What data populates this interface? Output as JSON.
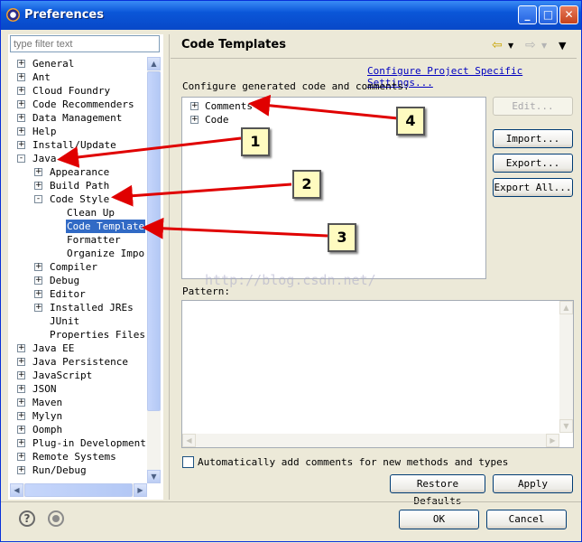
{
  "window": {
    "title": "Preferences"
  },
  "filter": {
    "placeholder": "type filter text"
  },
  "tree": [
    {
      "label": "General",
      "expander": "+",
      "selected": false
    },
    {
      "label": "Ant",
      "expander": "+",
      "selected": false
    },
    {
      "label": "Cloud Foundry",
      "expander": "+",
      "selected": false
    },
    {
      "label": "Code Recommenders",
      "expander": "+",
      "selected": false
    },
    {
      "label": "Data Management",
      "expander": "+",
      "selected": false
    },
    {
      "label": "Help",
      "expander": "+",
      "selected": false
    },
    {
      "label": "Install/Update",
      "expander": "+",
      "selected": false
    },
    {
      "label": "Java",
      "expander": "-",
      "selected": false
    },
    {
      "label": "Appearance",
      "expander": "+",
      "selected": false
    },
    {
      "label": "Build Path",
      "expander": "+",
      "selected": false
    },
    {
      "label": "Code Style",
      "expander": "-",
      "selected": false
    },
    {
      "label": "Clean Up",
      "expander": "",
      "selected": false
    },
    {
      "label": "Code Templates",
      "expander": "",
      "selected": true
    },
    {
      "label": "Formatter",
      "expander": "",
      "selected": false
    },
    {
      "label": "Organize Imports",
      "expander": "",
      "selected": false
    },
    {
      "label": "Compiler",
      "expander": "+",
      "selected": false
    },
    {
      "label": "Debug",
      "expander": "+",
      "selected": false
    },
    {
      "label": "Editor",
      "expander": "+",
      "selected": false
    },
    {
      "label": "Installed JREs",
      "expander": "+",
      "selected": false
    },
    {
      "label": "JUnit",
      "expander": "",
      "selected": false
    },
    {
      "label": "Properties Files Editor",
      "expander": "",
      "selected": false
    },
    {
      "label": "Java EE",
      "expander": "+",
      "selected": false
    },
    {
      "label": "Java Persistence",
      "expander": "+",
      "selected": false
    },
    {
      "label": "JavaScript",
      "expander": "+",
      "selected": false
    },
    {
      "label": "JSON",
      "expander": "+",
      "selected": false
    },
    {
      "label": "Maven",
      "expander": "+",
      "selected": false
    },
    {
      "label": "Mylyn",
      "expander": "+",
      "selected": false
    },
    {
      "label": "Oomph",
      "expander": "+",
      "selected": false
    },
    {
      "label": "Plug-in Development",
      "expander": "+",
      "selected": false
    },
    {
      "label": "Remote Systems",
      "expander": "+",
      "selected": false
    },
    {
      "label": "Run/Debug",
      "expander": "+",
      "selected": false
    }
  ],
  "page": {
    "title": "Code Templates",
    "project_link": "Configure Project Specific Settings...",
    "configure_label": "Configure generated code and comments:",
    "templates": [
      {
        "label": "Comments",
        "expander": "+"
      },
      {
        "label": "Code",
        "expander": "+"
      }
    ],
    "buttons": {
      "edit": "Edit...",
      "import": "Import...",
      "export": "Export...",
      "export_all": "Export All..."
    },
    "pattern_label": "Pattern:",
    "auto_comments_label": "Automatically add comments for new methods and types",
    "auto_comments_checked": false,
    "restore_defaults": "Restore Defaults",
    "apply": "Apply"
  },
  "footer": {
    "ok": "OK",
    "cancel": "Cancel"
  },
  "annotations": [
    "1",
    "2",
    "3",
    "4"
  ],
  "watermark": "http://blog.csdn.net/",
  "colors": {
    "title_bar": "#0a56d8",
    "selection": "#316ac5",
    "arrow": "#e00000",
    "callout": "#fffbc0"
  }
}
